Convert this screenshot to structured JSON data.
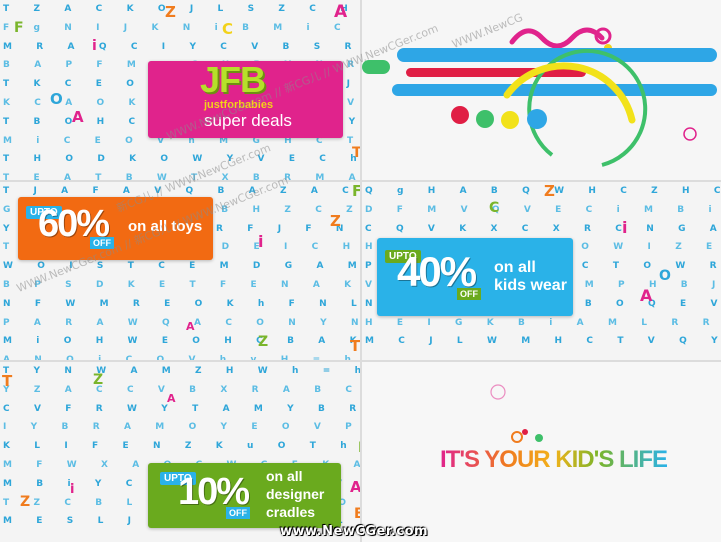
{
  "panels": {
    "p1": {
      "rows": [
        "T Z A C K O J L S Z C H W Q B A H g A",
        "F g N I J K N i B M i C E V Q V M F B",
        "M R A Q C I Y C V B S R P Y A W Y A W",
        "B A P F M q C U P Y N R P Y A W D U V",
        "T K C E O N T H A C Q J K C S E M O D",
        "K C A O K N E T N A K V Y A W T R I",
        "T B O H C B A Y M A B Y E O D A A T",
        "M i C E O V h M G H C T O D A K A A",
        "T H O D K O W Y V E C h h Z L Y C H",
        "T E A T B W T X B R M A W H V C C A Z"
      ],
      "card": {
        "brand": "JFB",
        "subbrand": "justforbabies",
        "tagline": "super deals"
      },
      "accent_letters": [
        "A",
        "Z",
        "F",
        "C",
        "i",
        "A",
        "O",
        "T"
      ]
    },
    "p3": {
      "rows": [
        "T J A F A V Q B A Z A C Z K O T Y W Q",
        "G T G Y N E B B H Z C Z K Q J N E Q M",
        "Y K Y C L I K R F J F N Z E I K L S Z",
        "T L Y H M A S D E I C H V A C Y i B Q",
        "W O I S T C E M D G A M H E W S S W T",
        "B P S D K E T F E N A K F C W C A X F W",
        "N F W M R E O K h F N L A C N I F A V C",
        "P A R A W Q A C O N Y N A T M P Q S O W",
        "M i O H W E O H C B A K R V C C A Z D",
        "A N Q i C O V h v H = h M K O X T"
      ],
      "card": {
        "upto": "UPTO",
        "percent": "60%",
        "off": "OFF",
        "text": "on all toys"
      },
      "accent_letters": [
        "F",
        "Z",
        "i",
        "A",
        "Z",
        "T"
      ]
    },
    "p4": {
      "rows": [
        "Q g H A B Q W H C Z H C O Q Y W Y",
        "D F M V Q V E C i M B i N K J i N g F",
        "C Q V K X C X R C N G A V F Q A R M V",
        "H D E T O Q I O W I Z E J E K O D A C",
        "P F T O C B C C T O W R I H i v G T C",
        "V N T O U R B M P H B J O u T h N E W",
        "N C I D W O K B O Q E V S Q N E A T F",
        "H E I G K B i A M L R R O A M Y E L E S",
        "M C J L W M H C T V Q Y M h V O T E D",
        "T F R W Y T B R V C T E W O K D B H A",
        "T Y V M Z H P W C A M B X T C H W E C"
      ],
      "card": {
        "upto": "UPTO",
        "percent": "40%",
        "off": "OFF",
        "text_line1": "on all",
        "text_line2": "kids wear"
      },
      "accent_letters": [
        "Z",
        "C",
        "i",
        "O",
        "A"
      ]
    },
    "p5": {
      "rows": [
        "T Y N W A M Z H W h = h c i O I Q N A",
        "Y Z A C C V B X R A B C H O E E W D Q",
        "C V F R W Y T A M Y B R O K W H O i A",
        "I Y B R A M O Y E O V P C N Q O V M Q",
        "K L I F E N Z K u O T h C R E A T I O N",
        "M F W X A O C W C F K A N E F P Q Y N",
        "M B i Y C i Q i Y L F V N A H E L T D Y",
        "T Z C B L Q J H S I N O Y U B P E T A",
        "M E S L J i N X O I B L H C B I I O T A"
      ],
      "card": {
        "upto": "UPTO",
        "percent": "10%",
        "off": "OFF",
        "text_line1": "on all",
        "text_line2": "designer",
        "text_line3": "cradles"
      },
      "accent_letters": [
        "T",
        "Z",
        "A",
        "F",
        "A",
        "Z",
        "i",
        "E"
      ]
    },
    "p6": {
      "tagline": "IT'S YOUR KID'S LIFE"
    }
  },
  "watermark": {
    "text_a": "WWW.NewCGer.com // 新CG儿 // WWW.NewCGer.com",
    "text_b": "WWW.NewCGer.com // 新CG儿 // WWW.NewCGer.com",
    "text_c": "WWW.NewCG",
    "text_d": "新CG儿 // WWW.NewCGer.com"
  },
  "footer": {
    "site": "www.NewCGer.com"
  },
  "colors": {
    "letters": "#2ea6d9",
    "jfb_card": "#e0238c",
    "p3_card": "#f26a12",
    "p4_card": "#2ab2e8",
    "p5_card": "#6aaa1e",
    "accent_orange": "#f07c1e",
    "accent_pink": "#e0238c",
    "accent_green": "#7ab52b",
    "accent_yellow": "#f2d21a"
  }
}
